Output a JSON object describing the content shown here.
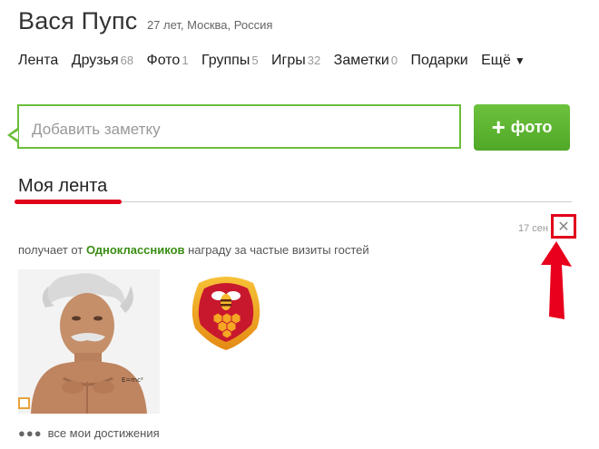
{
  "profile": {
    "name": "Вася Пупс",
    "meta": "27 лет, Москва, Россия"
  },
  "nav": [
    {
      "label": "Лента",
      "count": ""
    },
    {
      "label": "Друзья",
      "count": "68"
    },
    {
      "label": "Фото",
      "count": "1"
    },
    {
      "label": "Группы",
      "count": "5"
    },
    {
      "label": "Игры",
      "count": "32"
    },
    {
      "label": "Заметки",
      "count": "0"
    },
    {
      "label": "Подарки",
      "count": ""
    },
    {
      "label": "Ещё",
      "count": ""
    }
  ],
  "composer": {
    "placeholder": "Добавить заметку",
    "photo_button": "фото",
    "photo_button_icon": "plus-icon"
  },
  "feed": {
    "title": "Моя лента",
    "event": {
      "timestamp": "17 сен",
      "text_before": "получает от ",
      "link": "Одноклассников",
      "text_after": " награду за частые визиты гостей",
      "close_icon": "close-icon",
      "badge_icon": "bee-honeycomb-badge"
    },
    "more_link": "все мои достижения"
  },
  "colors": {
    "accent_green": "#5cb531",
    "link_green": "#3a8d14",
    "annotation_red": "#e0001a"
  }
}
